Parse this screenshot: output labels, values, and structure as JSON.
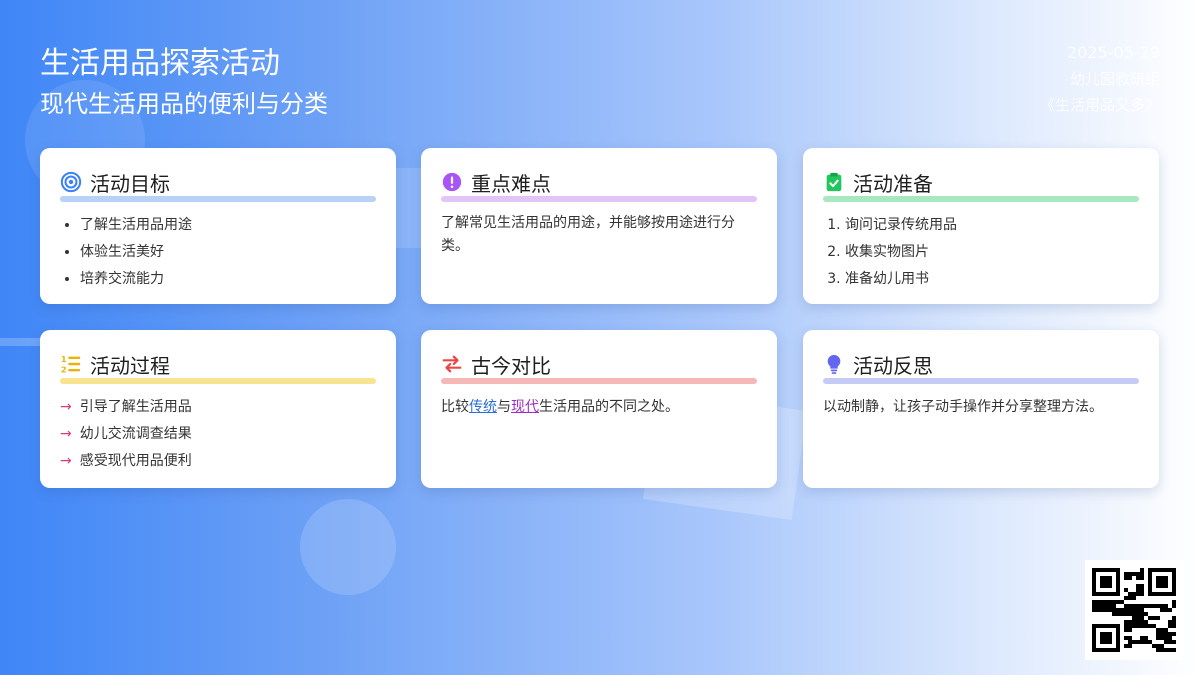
{
  "header": {
    "title": "生活用品探索活动",
    "subtitle": "现代生活用品的便利与分类",
    "date": "2025-05-29",
    "org": "幼儿园教研组",
    "course": "《生活用品又多》"
  },
  "cards": [
    {
      "title": "活动目标",
      "icon": "target-icon",
      "accent": "#b7d2f5",
      "items": [
        "了解生活用品用途",
        "体验生活美好",
        "培养交流能力"
      ]
    },
    {
      "title": "重点难点",
      "icon": "exclamation-icon",
      "accent": "#e3c4f6",
      "text": "了解常见生活用品的用途，并能够按用途进行分类。"
    },
    {
      "title": "活动准备",
      "icon": "clipboard-check-icon",
      "accent": "#a7e8c0",
      "items": [
        "询问记录传统用品",
        "收集实物图片",
        "准备幼儿用书"
      ]
    },
    {
      "title": "活动过程",
      "icon": "numbered-list-icon",
      "accent": "#f8e391",
      "items": [
        "引导了解生活用品",
        "幼儿交流调查结果",
        "感受现代用品便利"
      ]
    },
    {
      "title": "古今对比",
      "icon": "swap-arrows-icon",
      "accent": "#f5b8b6",
      "text_parts": {
        "prefix": "比较",
        "link1": "传统",
        "mid": "与",
        "link2": "现代",
        "suffix": "生活用品的不同之处。"
      }
    },
    {
      "title": "活动反思",
      "icon": "lightbulb-icon",
      "accent": "#c6cbf6",
      "text": "以动制静，让孩子动手操作并分享整理方法。"
    }
  ],
  "qr": {
    "icon": "qr-code-icon"
  }
}
